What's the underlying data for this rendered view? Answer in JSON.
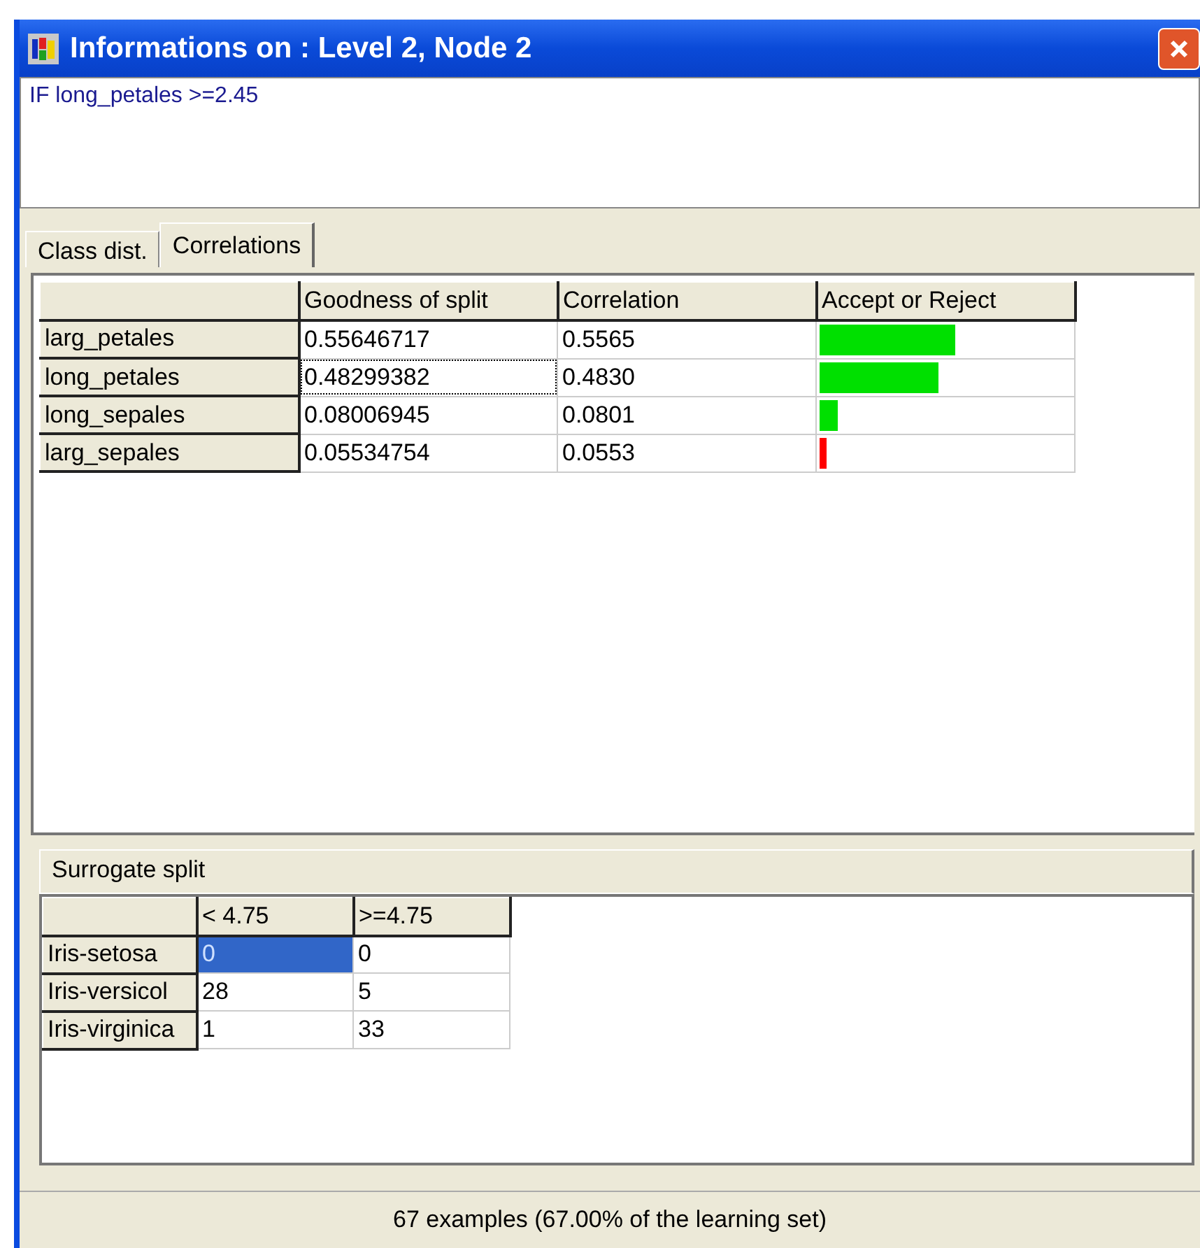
{
  "window": {
    "title": "Informations on : Level 2, Node 2"
  },
  "rule": "IF long_petales >=2.45",
  "tabs": [
    {
      "label": "Class dist.",
      "selected": false
    },
    {
      "label": "Correlations",
      "selected": true
    }
  ],
  "correlations": {
    "columns": [
      "Goodness of split",
      "Correlation",
      "Accept or Reject"
    ],
    "rows": [
      {
        "label": "larg_petales",
        "goodness": "0.55646717",
        "correlation": "0.5565",
        "level": 0.54,
        "color": "#00e000",
        "focused": false
      },
      {
        "label": "long_petales",
        "goodness": "0.48299382",
        "correlation": "0.4830",
        "level": 0.47,
        "color": "#00e000",
        "focused": true
      },
      {
        "label": "long_sepales",
        "goodness": "0.08006945",
        "correlation": "0.0801",
        "level": 0.07,
        "color": "#00e000",
        "focused": false
      },
      {
        "label": "larg_sepales",
        "goodness": "0.05534754",
        "correlation": "0.0553",
        "level": 0.03,
        "color": "#ff0000",
        "focused": false
      }
    ]
  },
  "surrogate": {
    "title": "Surrogate split",
    "columns": [
      "< 4.75",
      ">=4.75"
    ],
    "rows": [
      {
        "label": "Iris-setosa",
        "cells": [
          {
            "value": "0",
            "selected": true
          },
          {
            "value": "0",
            "selected": false
          }
        ]
      },
      {
        "label": "Iris-versicol",
        "cells": [
          {
            "value": "28",
            "selected": false
          },
          {
            "value": "5",
            "selected": false
          }
        ]
      },
      {
        "label": "Iris-virginica",
        "cells": [
          {
            "value": "1",
            "selected": false
          },
          {
            "value": "33",
            "selected": false
          }
        ]
      }
    ]
  },
  "status_bar": "67 examples (67.00% of the learning set)"
}
